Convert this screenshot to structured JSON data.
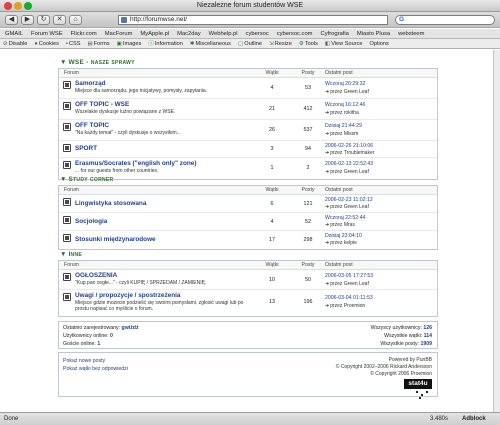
{
  "window": {
    "title": "Niezależne forum studentów WSE"
  },
  "toolbar": {
    "url": "http://forumwse.net/",
    "search_engine": "G"
  },
  "bookmarks": [
    "GMAIL",
    "Forum WSE",
    "Flickr.com",
    "MacForum",
    "MyApple.pl",
    "Mac2day",
    "Webhelp.pl",
    "cybersoc",
    "cybersoc.com",
    "Cyfrografia",
    "Miasto Plusa",
    "websteem"
  ],
  "devbar": [
    "Disable",
    "Cookies",
    "CSS",
    "Forms",
    "Images",
    "Information",
    "Miscellaneous",
    "Outline",
    "Resize",
    "Tools",
    "View Source",
    "Options"
  ],
  "columns": {
    "forum": "Forum",
    "topics": "Wątki",
    "posts": "Posty",
    "last": "Ostatni post"
  },
  "categories": [
    {
      "title": "WSE - nasze sprawy",
      "forums": [
        {
          "name": "Samorząd",
          "desc": "Miejsce dla samorządu, jego inicjatywy, pomysły, zapytania.",
          "topics": "4",
          "posts": "53",
          "last_date": "Wczoraj 20:29:32",
          "last_by": "przez Green Leaf"
        },
        {
          "name": "OFF TOPIC - WSE",
          "desc": "Wszelakie dyskusje luźno powiązane z WSE.",
          "topics": "21",
          "posts": "412",
          "last_date": "Wczoraj 16:12:46",
          "last_by": "przez rokitha"
        },
        {
          "name": "OFF TOPIC",
          "desc": "\"Na każdy temat\" - czyli dyskusje o wszystkim...",
          "topics": "26",
          "posts": "537",
          "last_date": "Dzisiaj 21:44:29",
          "last_by": "przez Missm"
        },
        {
          "name": "SPORT",
          "desc": "",
          "topics": "3",
          "posts": "94",
          "last_date": "2006-02-26 21:10:06",
          "last_by": "przez Troublemaker"
        },
        {
          "name": "Erasmus/Socrates (\"english only\" zone)",
          "desc": "... for our guests from other countries.",
          "topics": "1",
          "posts": "2",
          "last_date": "2006-02-13 22:52:43",
          "last_by": "przez Green Leaf"
        }
      ]
    },
    {
      "title": "Study corner",
      "forums": [
        {
          "name": "Lingwistyka stosowana",
          "desc": "",
          "topics": "6",
          "posts": "121",
          "last_date": "2006-02-23 11:02:12",
          "last_by": "przez Green Leaf"
        },
        {
          "name": "Socjologia",
          "desc": "",
          "topics": "4",
          "posts": "52",
          "last_date": "Wczoraj 22:52:44",
          "last_by": "przez Mras"
        },
        {
          "name": "Stosunki międzynarodowe",
          "desc": "",
          "topics": "17",
          "posts": "298",
          "last_date": "Dzisiaj 23:04:10",
          "last_by": "przez kelpie"
        }
      ]
    },
    {
      "title": "Inne",
      "forums": [
        {
          "name": "OGŁOSZENIA",
          "desc": "\"Kup pan cegłe...\" - czyli KUPIĘ / SPRZEDAM / ZAMIENIĘ.",
          "topics": "10",
          "posts": "50",
          "last_date": "2006-03-05 17:27:53",
          "last_by": "przez Green Leaf"
        },
        {
          "name": "Uwagi / propozycje / spostrzeżenia",
          "desc": "Miejsce gdzie możecie podzielić się swoimi pomysłami, zgłosić uwagi lub po prostu napisać co myślicie o forum.",
          "topics": "13",
          "posts": "196",
          "last_date": "2006-03-04 01:11:53",
          "last_by": "przez Proemion"
        }
      ]
    }
  ],
  "stats": {
    "last_user_label": "Ostatnio zarejestrowany:",
    "last_user": "gwiżdż",
    "online_users_label": "Użytkownicy online:",
    "online_users": "0",
    "guests_label": "Goście online:",
    "guests": "1",
    "total_users_label": "Wszyscy użytkownicy:",
    "total_users": "126",
    "total_topics_label": "Wszystkie wątki:",
    "total_topics": "114",
    "total_posts_label": "Wszystkie posty:",
    "total_posts": "1909"
  },
  "footer": {
    "link1": "Pokaż nowe posty",
    "link2": "Pokaż wątki bez odpowiedzi",
    "powered": "Powered by PunBB",
    "copy1": "© Copyright 2002–2006 Rickard Andersson",
    "copy2": "© Copyright 2006 Proemion",
    "badge": "stat4u"
  },
  "status": {
    "text": "Done",
    "time": "3.480s",
    "adblock": "Adblock"
  }
}
